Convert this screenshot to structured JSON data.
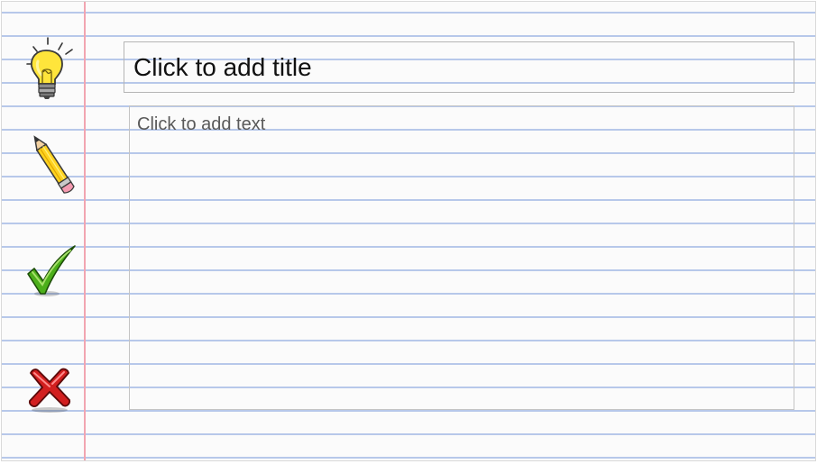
{
  "slide": {
    "title_placeholder": "Click to add title",
    "body_placeholder": "Click to add text"
  },
  "icons": [
    "lightbulb-icon",
    "pencil-icon",
    "checkmark-icon",
    "x-mark-icon"
  ],
  "colors": {
    "ruled_line": "#b7c8ea",
    "margin_line": "#f2a5b1",
    "check_green": "#4caf1a",
    "x_red": "#d21f1f",
    "bulb_yellow": "#ffe53b"
  }
}
